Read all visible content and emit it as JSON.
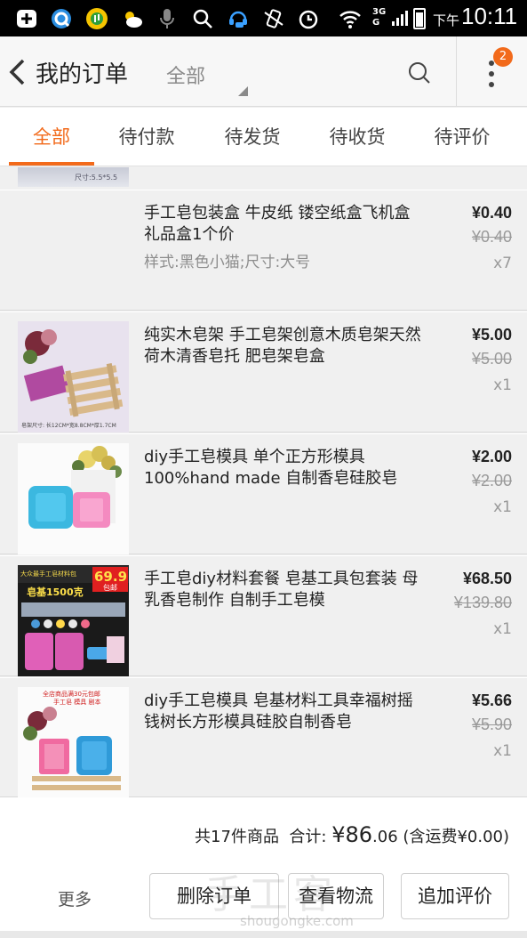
{
  "status_bar": {
    "network": "3G",
    "network_sub": "G",
    "ampm": "下午",
    "time": "10:11"
  },
  "header": {
    "title": "我的订单",
    "filter": "全部",
    "notification_count": "2"
  },
  "tabs": [
    {
      "label": "全部",
      "active": true
    },
    {
      "label": "待付款",
      "active": false
    },
    {
      "label": "待发货",
      "active": false
    },
    {
      "label": "待收货",
      "active": false
    },
    {
      "label": "待评价",
      "active": false
    }
  ],
  "partial_item": {
    "thumb_caption": "尺寸:5.5*5.5"
  },
  "items": [
    {
      "title": "手工皂包装盒 牛皮纸 镂空纸盒飞机盒 礼品盒1个价",
      "sku": "样式:黑色小猫;尺寸:大号",
      "price": "¥0.40",
      "original_price": "¥0.40",
      "quantity": "x7"
    },
    {
      "title": "纯实木皂架 手工皂架创意木质皂架天然荷木清香皂托 肥皂架皂盒",
      "price": "¥5.00",
      "original_price": "¥5.00",
      "quantity": "x1",
      "thumb_caption": "皂架尺寸: 长12CM*宽8.8CM*厚1.7CM"
    },
    {
      "title": "diy手工皂模具 单个正方形模具100%hand made 自制香皂硅胶皂",
      "price": "¥2.00",
      "original_price": "¥2.00",
      "quantity": "x1"
    },
    {
      "title": "手工皂diy材料套餐 皂基工具包套装 母乳香皂制作 自制手工皂模",
      "price": "¥68.50",
      "original_price": "¥139.80",
      "quantity": "x1",
      "thumb_banner": "大众最手工皂材料包",
      "thumb_promo": "69.9",
      "thumb_promo_sub": "包邮",
      "thumb_label": "皂基1500克"
    },
    {
      "title": "diy手工皂模具 皂基材料工具幸福树摇钱树长方形模具硅胶自制香皂",
      "price": "¥5.66",
      "original_price": "¥5.90",
      "quantity": "x1",
      "thumb_banner": "全店商品满30元包邮",
      "thumb_banner_sub": "手工皂 模具 剧本"
    }
  ],
  "footer": {
    "count_text": "共17件商品",
    "total_label": "合计:",
    "currency": "¥",
    "total_int": "86",
    "total_dec": ".06",
    "shipping": "(含运费¥0.00)",
    "more_label": "更多",
    "delete_label": "删除订单",
    "logistics_label": "查看物流",
    "review_label": "追加评价",
    "watermark_cn": "手工客",
    "watermark_en": "shougongke.com"
  },
  "colors": {
    "accent": "#f26a1b",
    "background": "#f0f0f0"
  }
}
